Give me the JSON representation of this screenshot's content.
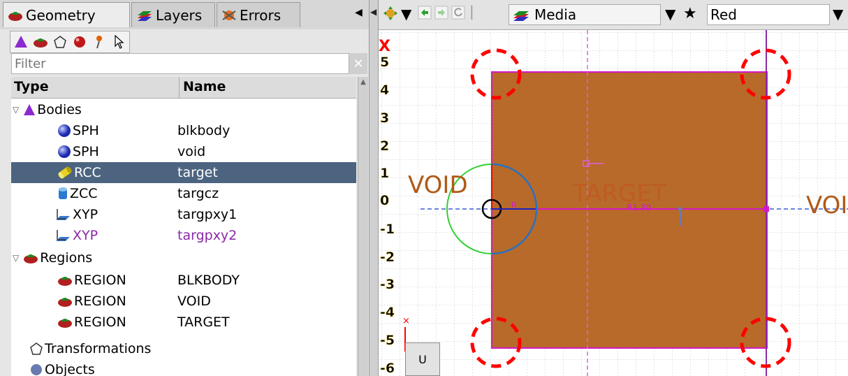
{
  "tabs": [
    {
      "label": "Geometry",
      "icon": "region-icon",
      "active": true
    },
    {
      "label": "Layers",
      "icon": "layers-icon",
      "active": false
    },
    {
      "label": "Errors",
      "icon": "bug-icon",
      "active": false
    }
  ],
  "toolbar_left": [
    "body-icon",
    "region-icon",
    "transformation-icon",
    "object-icon",
    "probe-icon",
    "pointer-icon"
  ],
  "filter": {
    "placeholder": "Filter",
    "value": ""
  },
  "tree": {
    "headers": {
      "type": "Type",
      "name": "Name"
    },
    "rows": [
      {
        "type": "Bodies",
        "name": "",
        "icon": "bodies-icon",
        "expanded": true,
        "level": 0
      },
      {
        "type": "SPH",
        "name": "blkbody",
        "icon": "sphere-icon",
        "level": 1
      },
      {
        "type": "SPH",
        "name": "void",
        "icon": "sphere-icon",
        "level": 1
      },
      {
        "type": "RCC",
        "name": "target",
        "icon": "cylinder-icon",
        "level": 1,
        "selected": true
      },
      {
        "type": "ZCC",
        "name": "targcz",
        "icon": "infinite-cylinder-icon",
        "level": 1
      },
      {
        "type": "XYP",
        "name": "targpxy1",
        "icon": "plane-icon",
        "level": 1
      },
      {
        "type": "XYP",
        "name": "targpxy2",
        "icon": "plane-icon",
        "level": 1,
        "highlight": "purple"
      },
      {
        "type": "Regions",
        "name": "",
        "icon": "regions-icon",
        "expanded": true,
        "level": 0
      },
      {
        "type": "REGION",
        "name": "BLKBODY",
        "icon": "region-icon",
        "level": 1
      },
      {
        "type": "REGION",
        "name": "VOID",
        "icon": "region-icon",
        "level": 1
      },
      {
        "type": "REGION",
        "name": "TARGET",
        "icon": "region-icon",
        "level": 1
      },
      {
        "type": "Transformations",
        "name": "",
        "icon": "transformation-icon",
        "level": 0
      },
      {
        "type": "Objects",
        "name": "",
        "icon": "object-icon",
        "level": 0
      }
    ]
  },
  "toolbar_right": {
    "media_label": "Media",
    "color_value": "Red"
  },
  "viewport": {
    "y_axis_ticks": [
      "5",
      "4",
      "3",
      "2",
      "1",
      "0",
      "-1",
      "-2",
      "-3",
      "-4",
      "-5",
      "-6"
    ],
    "labels": {
      "void_left": "VOID",
      "target": "TARGET",
      "void_right": "VOI",
      "small_axis": "R",
      "target_tag": "R1  30"
    },
    "axis_marker": "X",
    "u_button": "U",
    "colors": {
      "target_fill": "#b86a2a",
      "region_outline": "#d418c8",
      "highlight_circle": "#ff0000",
      "label": "#b05a18",
      "grid": "#c8c8c8"
    }
  }
}
